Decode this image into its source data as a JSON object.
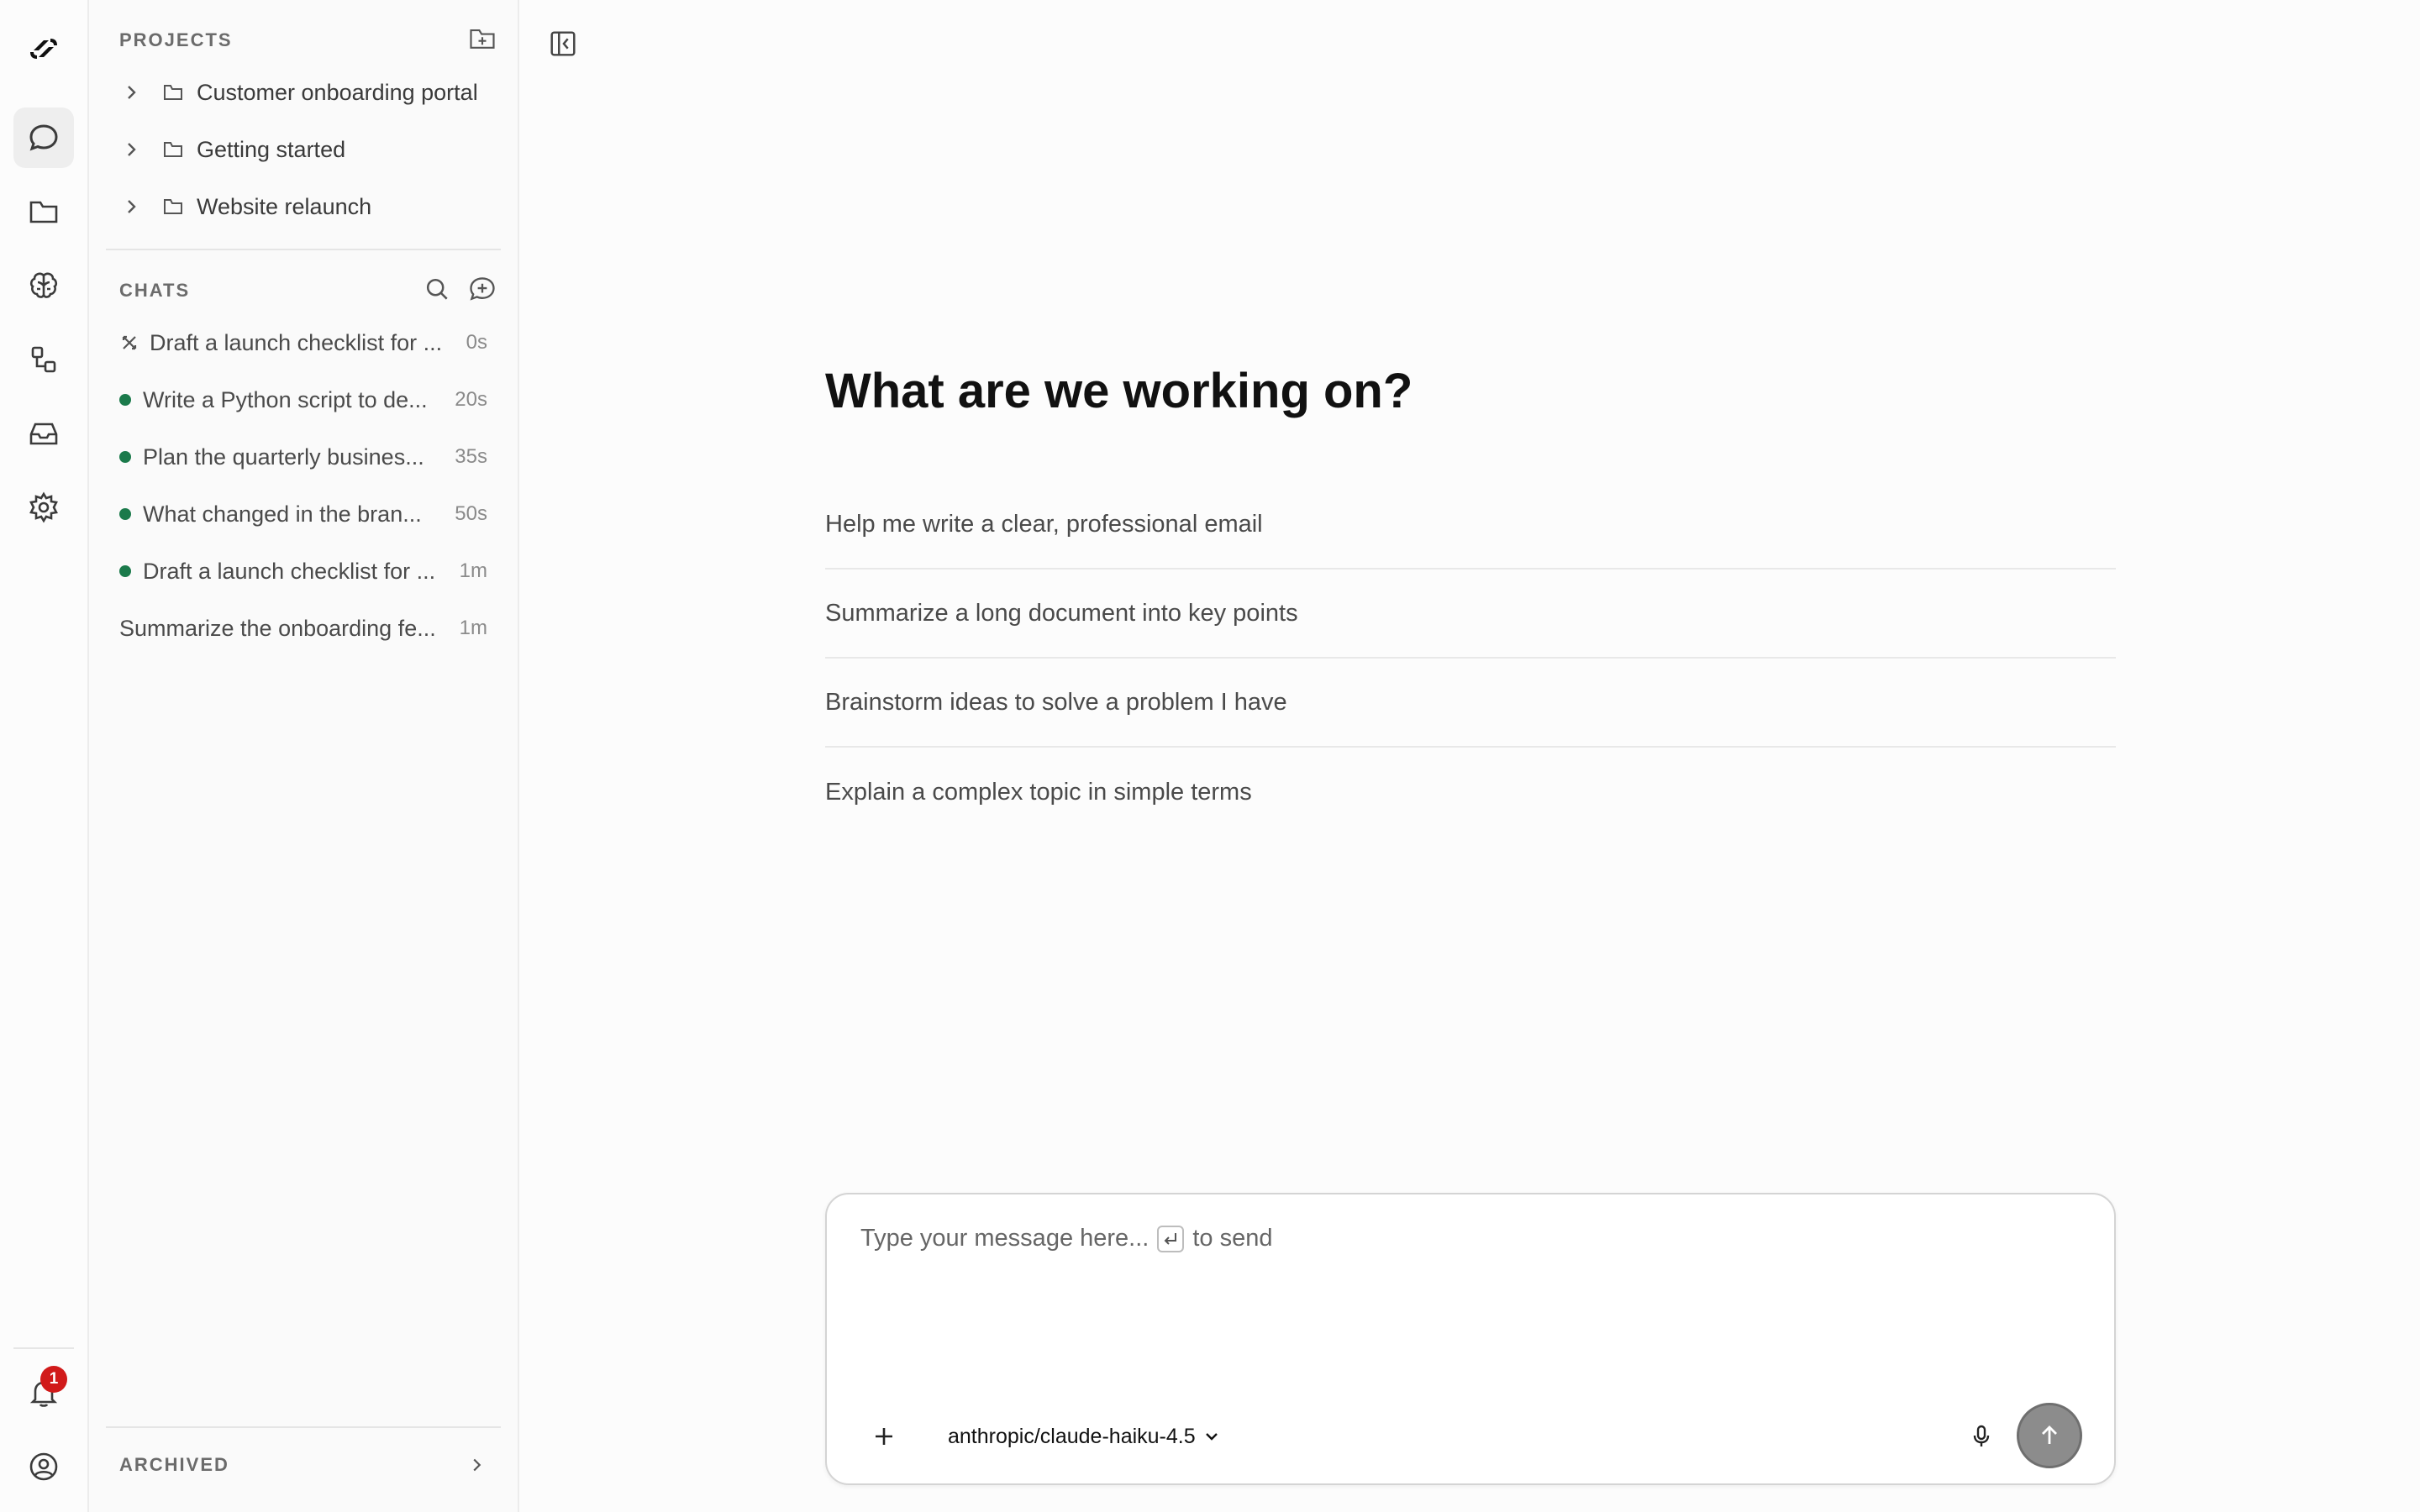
{
  "rail": {
    "items": [
      "logo-icon",
      "chat-icon",
      "folder-icon",
      "brain-icon",
      "workflow-icon",
      "inbox-icon",
      "gear-icon"
    ],
    "notification_count": "1"
  },
  "projects": {
    "heading": "PROJECTS",
    "items": [
      {
        "label": "Customer onboarding portal"
      },
      {
        "label": "Getting started"
      },
      {
        "label": "Website relaunch"
      }
    ]
  },
  "chats": {
    "heading": "CHATS",
    "items": [
      {
        "title": "Draft a launch checklist for ...",
        "time": "0s",
        "status": "running"
      },
      {
        "title": "Write a Python script to de...",
        "time": "20s",
        "status": "active"
      },
      {
        "title": "Plan the quarterly busines...",
        "time": "35s",
        "status": "active"
      },
      {
        "title": "What changed in the bran...",
        "time": "50s",
        "status": "active"
      },
      {
        "title": "Draft a launch checklist for ...",
        "time": "1m",
        "status": "active"
      },
      {
        "title": "Summarize the onboarding fe...",
        "time": "1m",
        "status": "none"
      }
    ]
  },
  "archived": {
    "label": "ARCHIVED"
  },
  "main": {
    "title": "What are we working on?",
    "suggestions": [
      "Help me write a clear, professional email",
      "Summarize a long document into key points",
      "Brainstorm ideas to solve a problem I have",
      "Explain a complex topic in simple terms"
    ]
  },
  "composer": {
    "placeholder": "Type your message here...",
    "send_hint": "to send",
    "model": "anthropic/claude-haiku-4.5"
  },
  "colors": {
    "status_dot": "#1b7a4b",
    "badge": "#d11a1a",
    "send_button": "#8c8c8c"
  }
}
